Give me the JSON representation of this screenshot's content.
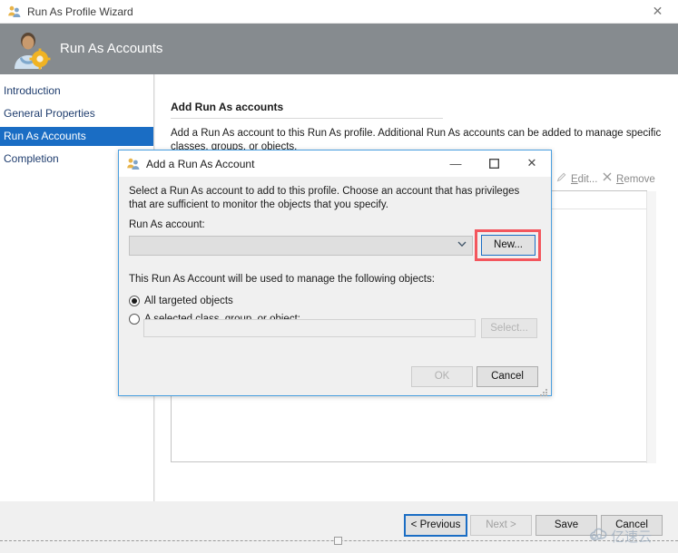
{
  "window": {
    "title": "Run As Profile Wizard",
    "title_icon": "users-icon",
    "close_label": "✕"
  },
  "banner": {
    "title": "Run As Accounts",
    "icon": "user-gear-icon",
    "bg": "#868b8f"
  },
  "sidebar": {
    "items": [
      {
        "label": "Introduction",
        "selected": false
      },
      {
        "label": "General Properties",
        "selected": false
      },
      {
        "label": "Run As Accounts",
        "selected": true
      },
      {
        "label": "Completion",
        "selected": false
      }
    ],
    "selected_bg": "#1a6dc4"
  },
  "content": {
    "heading": "Add Run As accounts",
    "description": "Add a Run As account to this Run As profile.  Additional Run As accounts can be added to manage specific classes, groups, or objects.",
    "toolbar": [
      {
        "label": "Edit...",
        "icon": "pencil-icon",
        "disabled": true
      },
      {
        "label": "Remove",
        "icon": "x-icon",
        "disabled": true
      }
    ],
    "list_rows": []
  },
  "footer": {
    "buttons": [
      {
        "label": "< Previous",
        "state": "focused"
      },
      {
        "label": "Next >",
        "state": "disabled"
      },
      {
        "label": "Save",
        "state": "normal"
      },
      {
        "label": "Cancel",
        "state": "normal"
      }
    ]
  },
  "dialog": {
    "title": "Add a Run As Account",
    "title_icon": "user-account-icon",
    "controls": {
      "minimize": "—",
      "maximize": "☐",
      "close": "✕"
    },
    "intro": "Select a Run As account to add to this profile.  Choose an account that has privileges that are sufficient to monitor the objects that you specify.",
    "account_label": "Run As account:",
    "account_value": "",
    "account_chevron": "⌄",
    "new_button": "New...",
    "new_button_highlight_color": "#f3565d",
    "objects_label": "This Run As Account will be used to manage the following objects:",
    "radios": [
      {
        "label": "All targeted objects",
        "checked": true
      },
      {
        "label": "A selected class, group, or object:",
        "checked": false
      }
    ],
    "select_input_value": "",
    "select_button": "Select...",
    "ok_button": "OK",
    "cancel_button": "Cancel"
  },
  "watermark": {
    "text": "亿速云",
    "icon": "cloud-icon",
    "color": "#9aabbd"
  }
}
